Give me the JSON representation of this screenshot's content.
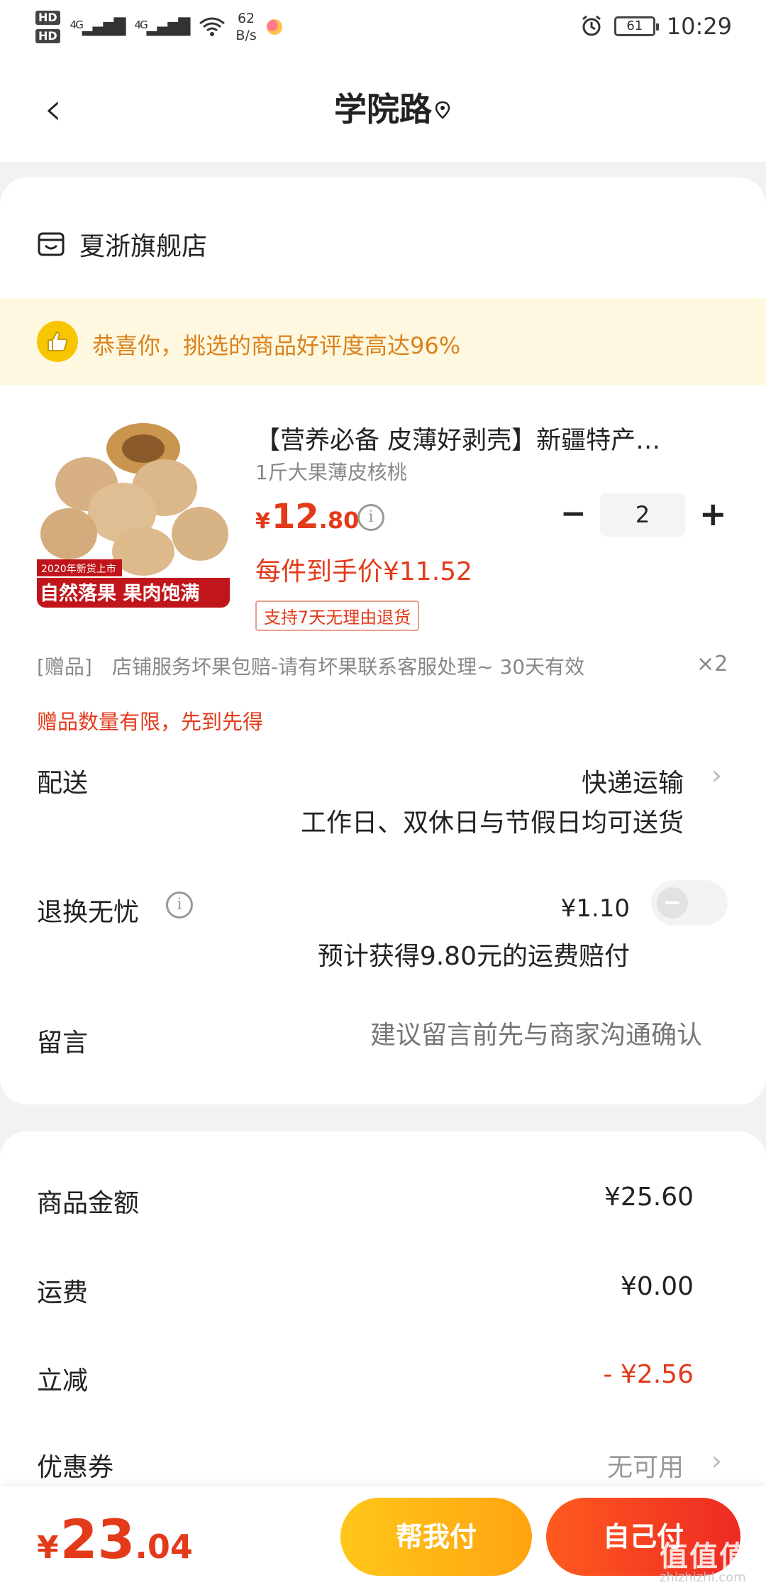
{
  "status_bar": {
    "hd1": "HD",
    "hd2": "HD",
    "signal1": "4G",
    "signal2": "4G",
    "net_speed_value": "62",
    "net_speed_unit": "B/s",
    "battery": "61",
    "time": "10:29"
  },
  "header": {
    "title": "学院路"
  },
  "store": {
    "name": "夏浙旗舰店"
  },
  "banner": {
    "text": "恭喜你，挑选的商品好评度高达96%"
  },
  "product": {
    "image_caption_small": "2020年新货上市",
    "image_caption_large": "自然落果  果肉饱满",
    "title": "【营养必备 皮薄好剥壳】新疆特产…",
    "subtitle": "1斤大果薄皮核桃",
    "price_currency": "¥",
    "price_int": "12",
    "price_dec": ".80",
    "quantity": "2",
    "deal_price": "每件到手价¥11.52",
    "return_tag": "支持7天无理由退货"
  },
  "gift": {
    "label": "[赠品]",
    "text": "店铺服务坏果包赔-请有坏果联系客服处理~ 30天有效",
    "qty": "×2",
    "limit_note": "赠品数量有限，先到先得"
  },
  "delivery": {
    "label": "配送",
    "value": "快递运输",
    "note": "工作日、双休日与节假日均可送货"
  },
  "refund": {
    "label": "退换无忧",
    "price": "¥1.10",
    "note": "预计获得9.80元的运费赔付",
    "enabled": false
  },
  "message": {
    "label": "留言",
    "placeholder": "建议留言前先与商家沟通确认"
  },
  "summary": {
    "goods_label": "商品金额",
    "goods_value": "¥25.60",
    "shipping_label": "运费",
    "shipping_value": "¥0.00",
    "discount_label": "立减",
    "discount_value": "- ¥2.56",
    "coupon_label": "优惠券",
    "coupon_value": "无可用"
  },
  "footer": {
    "total_currency": "¥",
    "total_int": "23",
    "total_dec": ".04",
    "help_pay": "帮我付",
    "self_pay": "自己付",
    "watermark": "值值值",
    "watermark_url": "zhizhizhi.com"
  },
  "colors": {
    "accent_red": "#e33a1a",
    "banner_bg": "#fff8e0",
    "banner_text": "#d9821e",
    "help_btn": "#ffb415",
    "self_btn": "#f0332a"
  }
}
